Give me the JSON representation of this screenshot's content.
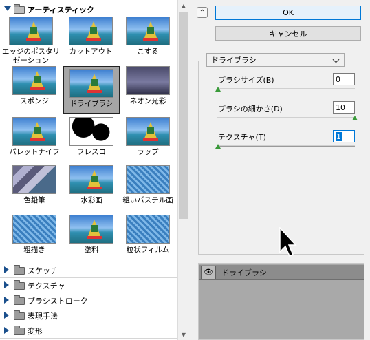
{
  "gallery": {
    "open_category": "アーティスティック",
    "thumbnails": [
      {
        "label": "エッジのポスタリゼーション"
      },
      {
        "label": "カットアウト"
      },
      {
        "label": "こする"
      },
      {
        "label": "スポンジ"
      },
      {
        "label": "ドライブラシ",
        "selected": true
      },
      {
        "label": "ネオン光彩"
      },
      {
        "label": "パレットナイフ"
      },
      {
        "label": "フレスコ"
      },
      {
        "label": "ラップ"
      },
      {
        "label": "色鉛筆"
      },
      {
        "label": "水彩画"
      },
      {
        "label": "粗いパステル画"
      },
      {
        "label": "粗描き"
      },
      {
        "label": "塗料"
      },
      {
        "label": "粒状フィルム"
      }
    ],
    "closed_categories": [
      "スケッチ",
      "テクスチャ",
      "ブラシストローク",
      "表現手法",
      "変形"
    ]
  },
  "buttons": {
    "ok": "OK",
    "cancel": "キャンセル"
  },
  "filter_select": {
    "value": "ドライブラシ"
  },
  "params": [
    {
      "label": "ブラシサイズ(B)",
      "value": "0"
    },
    {
      "label": "ブラシの細かさ(D)",
      "value": "10"
    },
    {
      "label": "テクスチャ(T)",
      "value": "1"
    }
  ],
  "layers": {
    "items": [
      {
        "name": "ドライブラシ",
        "visible": true
      }
    ]
  }
}
